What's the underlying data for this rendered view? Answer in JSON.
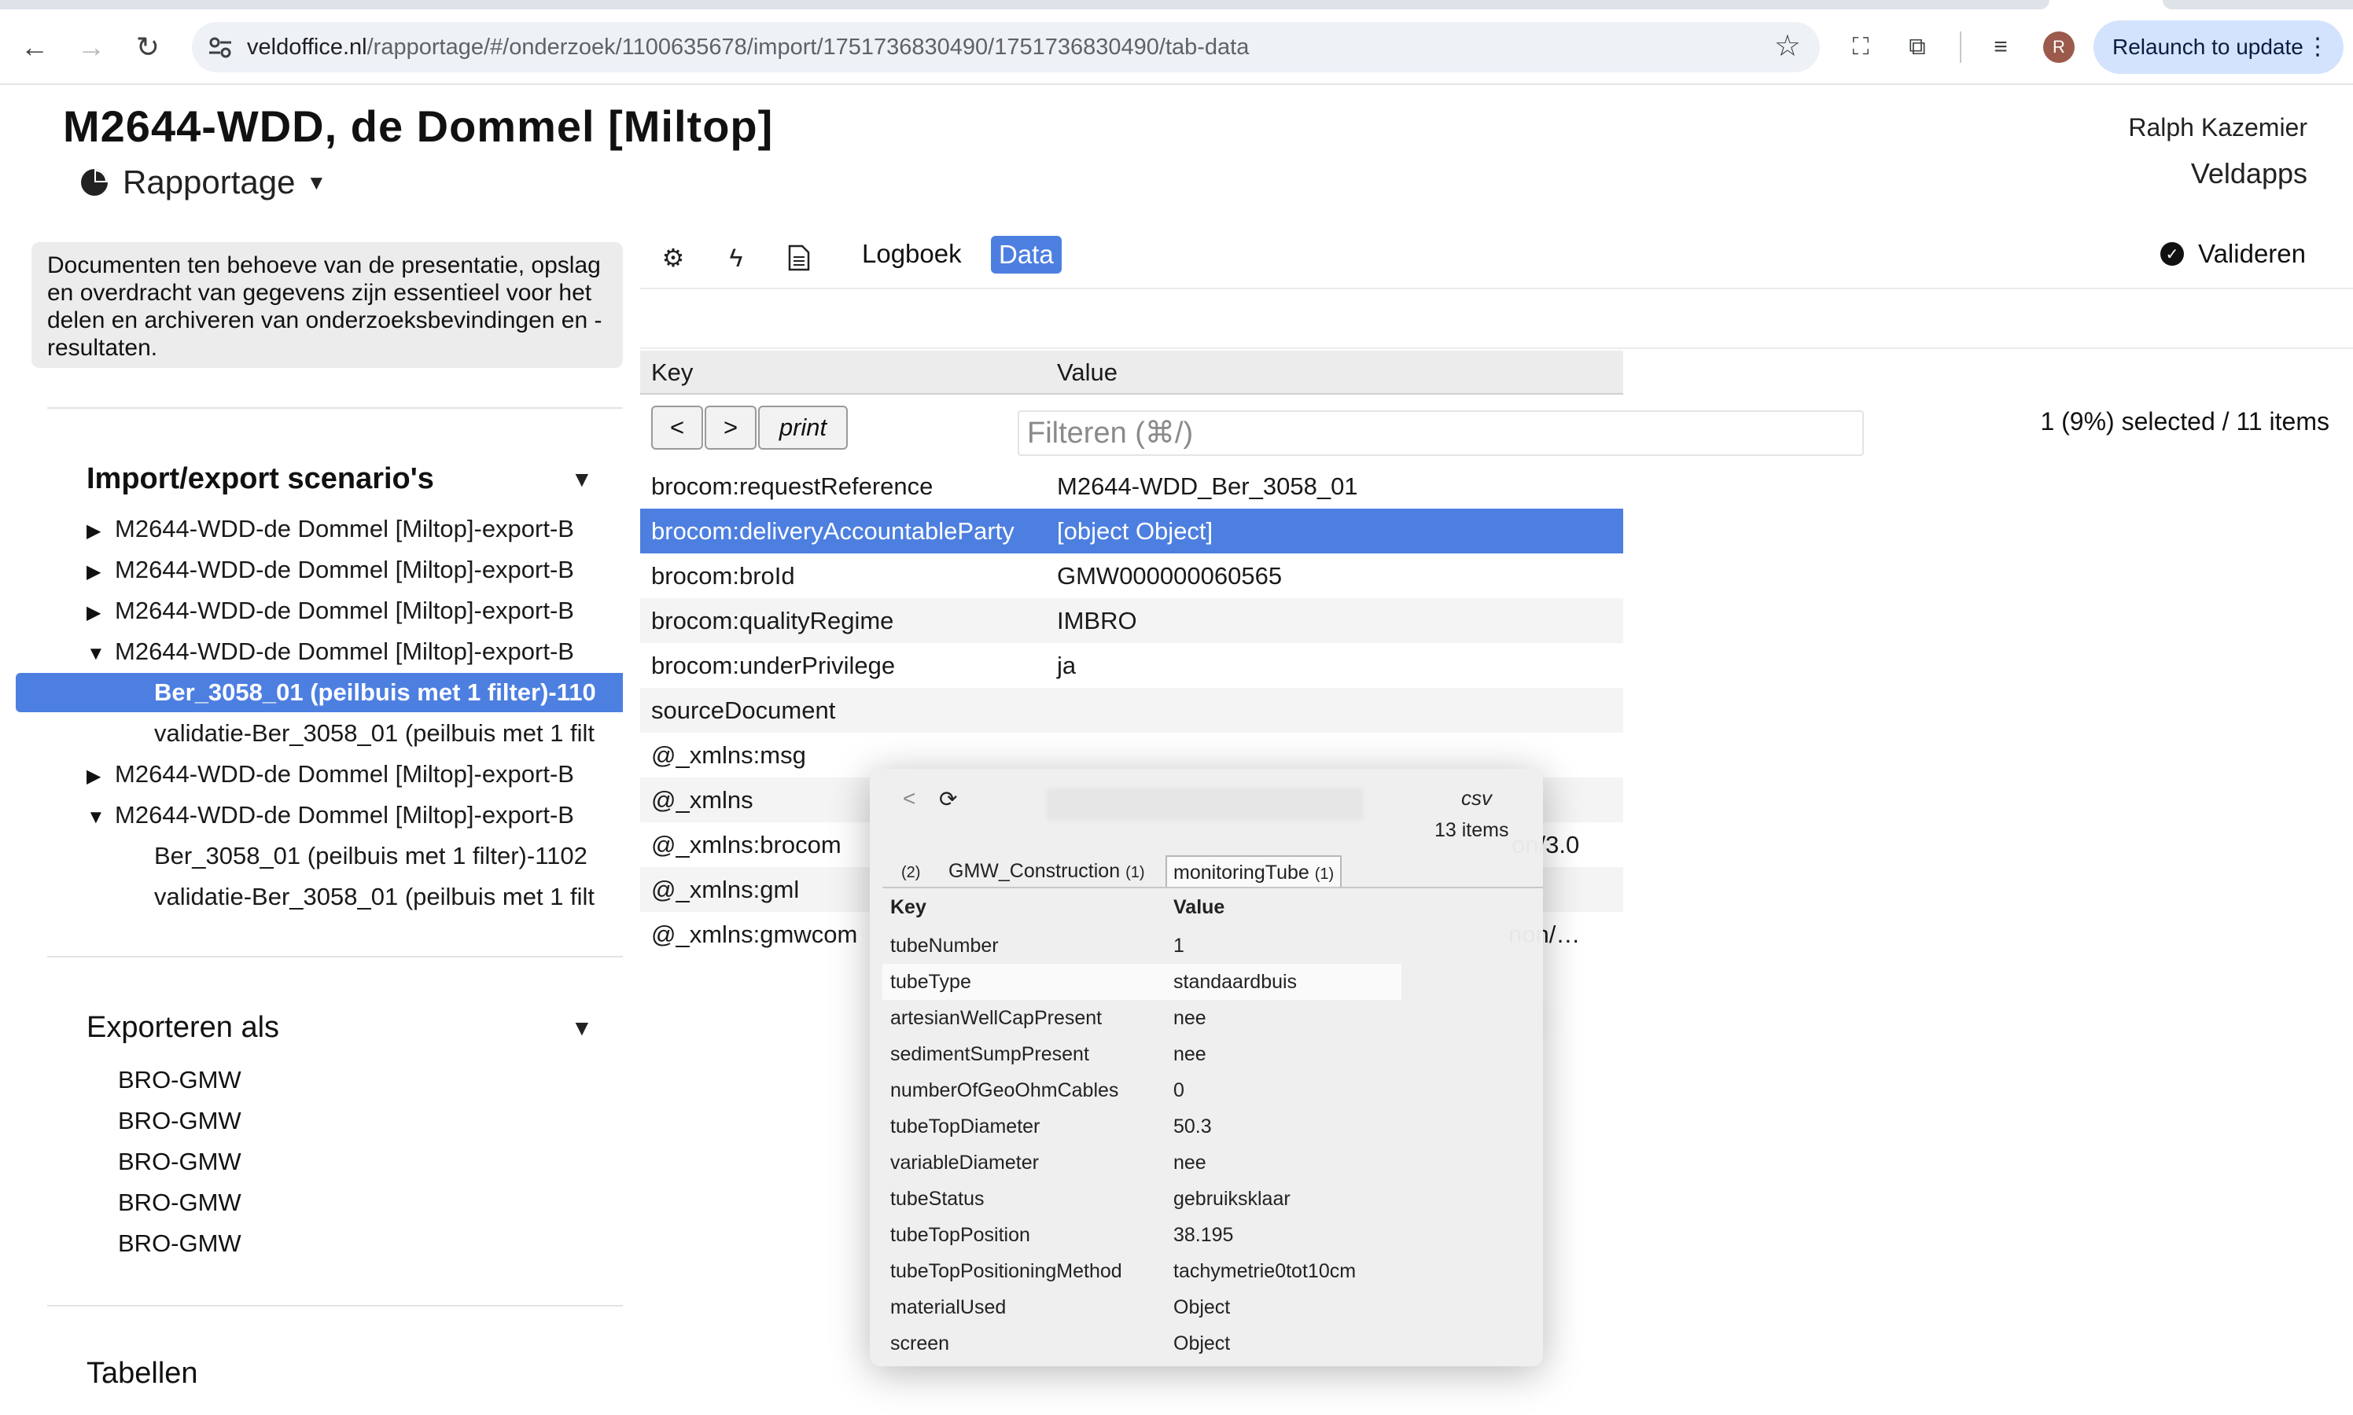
{
  "browser": {
    "url_host": "veldoffice.nl",
    "url_path": "/rapportage/#/onderzoek/1100635678/import/1751736830490/1751736830490/tab-data",
    "relaunch_label": "Relaunch to update",
    "avatar_letter": "R"
  },
  "header": {
    "title": "M2644-WDD, de Dommel [Miltop]",
    "menu_label": "Rapportage",
    "user_name": "Ralph Kazemier",
    "org_name": "Veldapps"
  },
  "sidebar": {
    "note": "Documenten ten behoeve van de presentatie, opslag en overdracht van gegevens zijn essentieel voor het delen en archiveren van onderzoeksbevindingen en -resultaten.",
    "scenarios_title": "Import/export scenario's",
    "tree": [
      {
        "label": "M2644-WDD-de Dommel [Miltop]-export-B",
        "expanded": false,
        "level": 0
      },
      {
        "label": "M2644-WDD-de Dommel [Miltop]-export-B",
        "expanded": false,
        "level": 0
      },
      {
        "label": "M2644-WDD-de Dommel [Miltop]-export-B",
        "expanded": false,
        "level": 0
      },
      {
        "label": "M2644-WDD-de Dommel [Miltop]-export-B",
        "expanded": true,
        "level": 0
      },
      {
        "label": "Ber_3058_01 (peilbuis met 1 filter)-110",
        "level": 1,
        "selected": true
      },
      {
        "label": "validatie-Ber_3058_01 (peilbuis met 1 filt",
        "level": 1
      },
      {
        "label": "M2644-WDD-de Dommel [Miltop]-export-B",
        "expanded": false,
        "level": 0
      },
      {
        "label": "M2644-WDD-de Dommel [Miltop]-export-B",
        "expanded": true,
        "level": 0
      },
      {
        "label": "Ber_3058_01 (peilbuis met 1 filter)-1102",
        "level": 1
      },
      {
        "label": "validatie-Ber_3058_01 (peilbuis met 1 filt",
        "level": 1
      }
    ],
    "export_title": "Exporteren als",
    "export_items": [
      "BRO-GMW",
      "BRO-GMW",
      "BRO-GMW",
      "BRO-GMW",
      "BRO-GMW"
    ],
    "tables_title": "Tabellen"
  },
  "toolbar": {
    "tab_logboek": "Logboek",
    "tab_data": "Data",
    "validate_label": "Valideren"
  },
  "table": {
    "col_key": "Key",
    "col_value": "Value",
    "btn_prev": "<",
    "btn_next": ">",
    "btn_print": "print",
    "filter_placeholder": "Filteren (⌘/)",
    "selection_info": "1 (9%) selected / 11 items",
    "rows": [
      {
        "key": "brocom:requestReference",
        "value": "M2644-WDD_Ber_3058_01"
      },
      {
        "key": "brocom:deliveryAccountableParty",
        "value": "[object Object]",
        "selected": true
      },
      {
        "key": "brocom:broId",
        "value": "GMW000000060565"
      },
      {
        "key": "brocom:qualityRegime",
        "value": "IMBRO"
      },
      {
        "key": "brocom:underPrivilege",
        "value": "ja"
      },
      {
        "key": "sourceDocument",
        "value": ""
      },
      {
        "key": "@_xmlns:msg",
        "value": ""
      },
      {
        "key": "@_xmlns",
        "value": ""
      },
      {
        "key": "@_xmlns:brocom",
        "value": "on/3.0"
      },
      {
        "key": "@_xmlns:gml",
        "value": ""
      },
      {
        "key": "@_xmlns:gmwcom",
        "value": "non/…"
      }
    ]
  },
  "popup": {
    "back": "<",
    "format": "csv",
    "count": "13 items",
    "tabs": [
      {
        "label": "(2)",
        "count": ""
      },
      {
        "label": "GMW_Construction",
        "count": "(1)"
      },
      {
        "label": "monitoringTube",
        "count": "(1)",
        "active": true
      }
    ],
    "col_key": "Key",
    "col_value": "Value",
    "rows": [
      {
        "key": "tubeNumber",
        "value": "1"
      },
      {
        "key": "tubeType",
        "value": "standaardbuis"
      },
      {
        "key": "artesianWellCapPresent",
        "value": "nee"
      },
      {
        "key": "sedimentSumpPresent",
        "value": "nee"
      },
      {
        "key": "numberOfGeoOhmCables",
        "value": "0"
      },
      {
        "key": "tubeTopDiameter",
        "value": "50.3"
      },
      {
        "key": "variableDiameter",
        "value": "nee"
      },
      {
        "key": "tubeStatus",
        "value": "gebruiksklaar"
      },
      {
        "key": "tubeTopPosition",
        "value": "38.195"
      },
      {
        "key": "tubeTopPositioningMethod",
        "value": "tachymetrie0tot10cm"
      },
      {
        "key": "materialUsed",
        "value": "Object"
      },
      {
        "key": "screen",
        "value": "Object"
      }
    ]
  },
  "colors": {
    "accent": "#4d7fe0",
    "relaunch_bg": "#d3e3fd"
  }
}
